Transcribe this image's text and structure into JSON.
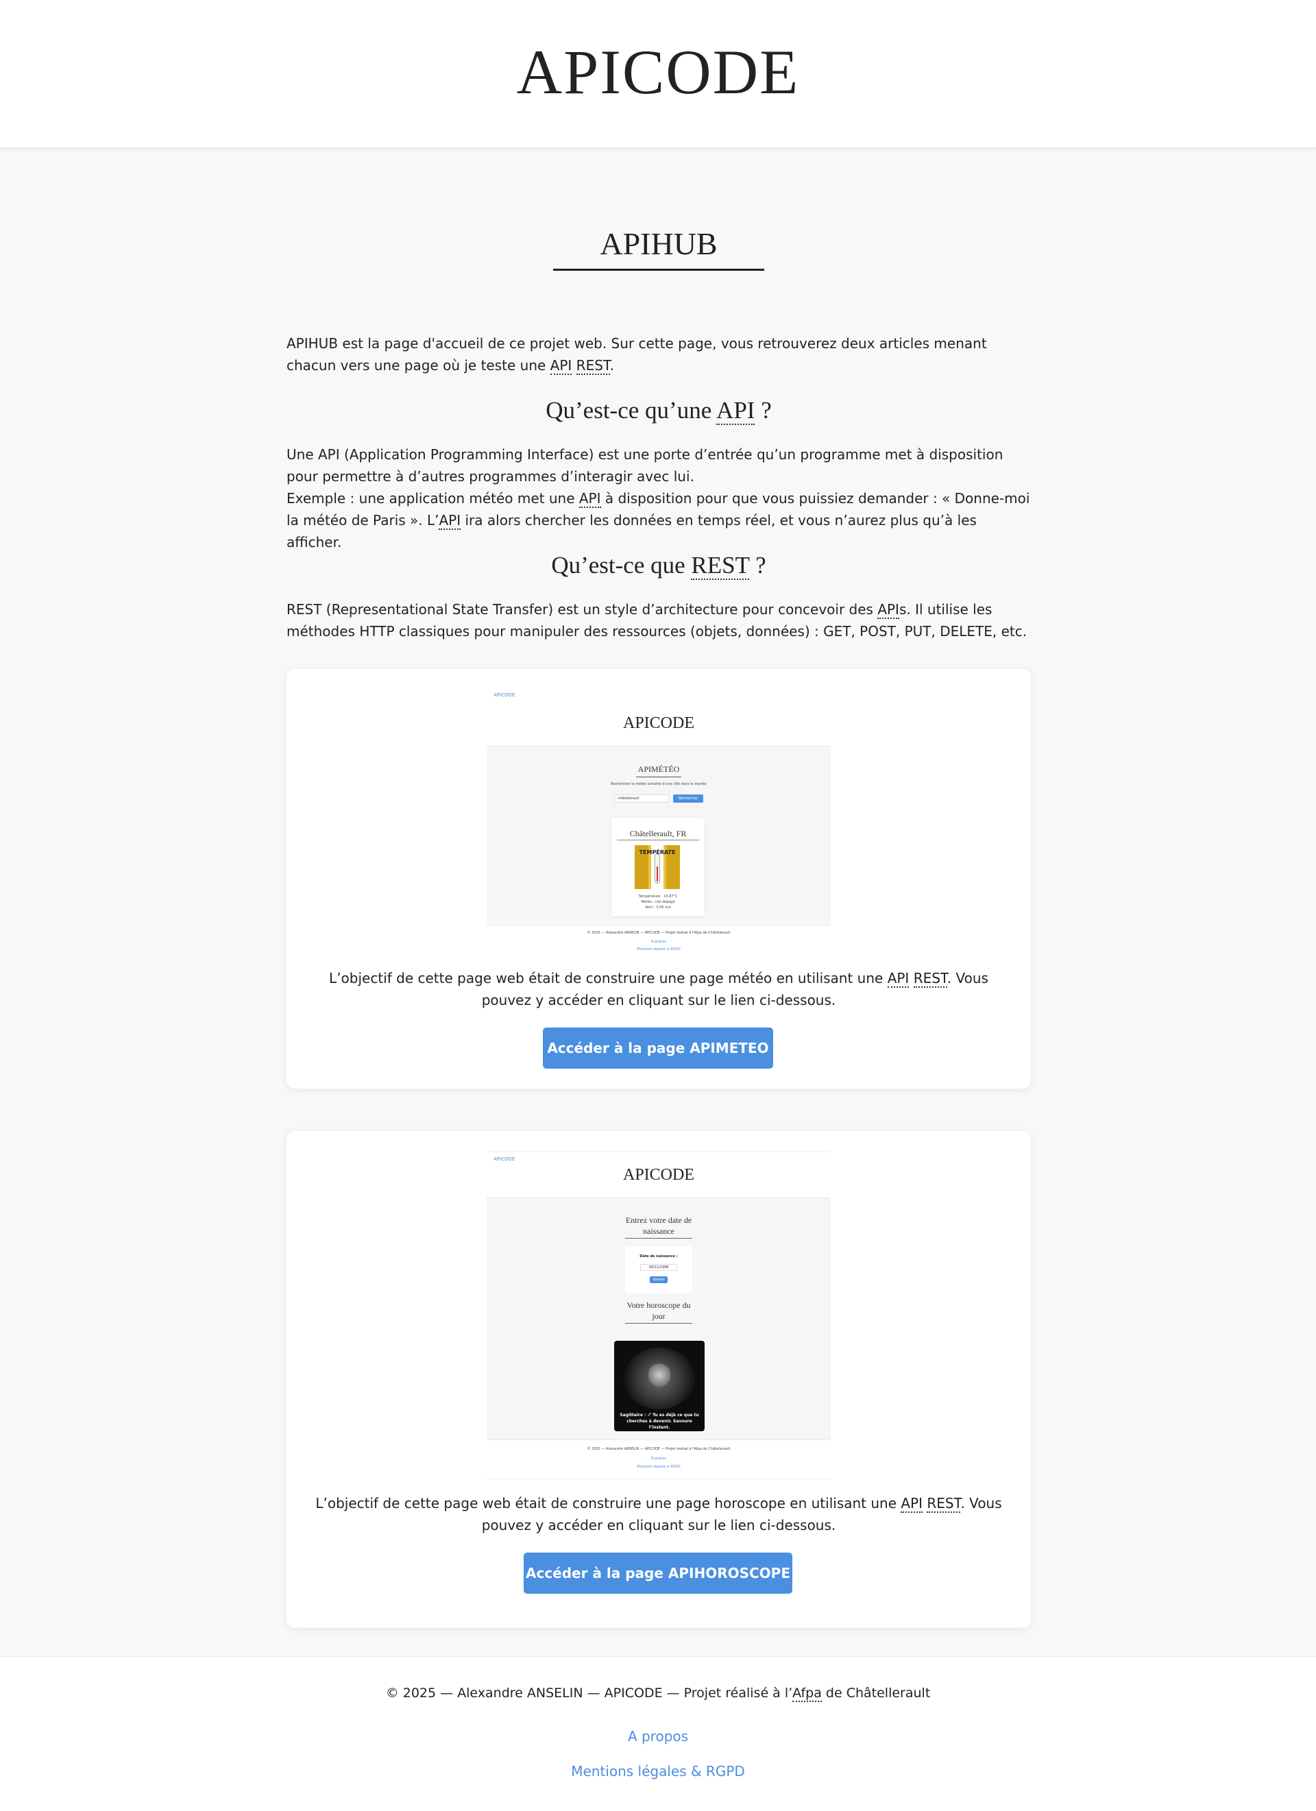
{
  "header": {
    "site_title": "APICODE"
  },
  "main": {
    "page_title": "APIHUB",
    "intro": {
      "text": "APIHUB est la page d'accueil de ce projet web. Sur cette page, vous retrouverez deux articles menant chacun vers une page où je teste une ",
      "abbr1": "API",
      "abbr2": "REST",
      "end": "."
    },
    "section_api": {
      "title_pre": "Qu’est-ce qu’une ",
      "title_abbr": "API",
      "title_post": " ?",
      "line1": "Une API (Application Programming Interface) est une porte d’entrée qu’un programme met à disposition pour permettre à d’autres programmes d’interagir avec lui.",
      "line2_pre": "Exemple : une application météo met une ",
      "line2_abbr1": "API",
      "line2_mid": " à disposition pour que vous puissiez demander : « Donne-moi la météo de Paris ». L’",
      "line2_abbr2": "API",
      "line2_post": " ira alors chercher les données en temps réel, et vous n’aurez plus qu’à les afficher."
    },
    "section_rest": {
      "title_pre": "Qu’est-ce que ",
      "title_abbr": "REST",
      "title_post": " ?",
      "text_pre": "REST (Representational State Transfer) est un style d’architecture pour concevoir des ",
      "text_abbr": "API",
      "text_post": "s. Il utilise les méthodes HTTP classiques pour manipuler des ressources (objets, données) : GET, POST, PUT, DELETE, etc."
    },
    "cards": [
      {
        "text_pre": "L’objectif de cette page web était de construire une page météo en utilisant une ",
        "abbr1": "API",
        "abbr2": "REST",
        "text_post": ". Vous pouvez y accéder en cliquant sur le lien ci-dessous.",
        "button": "Accéder à la page APIMETEO",
        "preview": {
          "logo": "APICODE",
          "site_title": "APICODE",
          "heading": "APIMÉTÉO",
          "subtitle": "Rechercher la météo actuelle d'une ville dans le monde",
          "search_value": "châtellerault",
          "search_button": "Rechercher",
          "city": "Châtellerault, FR",
          "badge": "TEMPÉRATE",
          "stat1": "Température : 19.87°C",
          "stat2": "Météo : ciel dégagé",
          "stat3": "Vent : 3.09 m/s",
          "footer": "© 2025 — Alexandre ANSELIN — APICODE — Projet réalisé à l'Afpa de Châtellerault",
          "link1": "À propos",
          "link2": "Mentions légales & RGPD"
        }
      },
      {
        "text_pre": "L’objectif de cette page web était de construire une page horoscope en utilisant une ",
        "abbr1": "API",
        "abbr2": "REST",
        "text_post": ". Vous pouvez y accéder en cliquant sur le lien ci-dessous.",
        "button": "Accéder à la page APIHOROSCOPE",
        "preview": {
          "logo": "APICODE",
          "site_title": "APICODE",
          "heading1": "Entrez votre date de naissance",
          "form_label": "Date de naissance :",
          "date_value": "06/11/1998",
          "submit": "Valider",
          "heading2": "Votre horoscope du jour",
          "caption": "Sagittaire : ♐ Tu es déjà ce que tu cherches à devenir. Savoure l’instant.",
          "footer": "© 2025 — Alexandre ANSELIN — APICODE — Projet réalisé à l'Afpa de Châtellerault",
          "link1": "À propos",
          "link2": "Mentions légales & RGPD"
        }
      }
    ]
  },
  "footer": {
    "copy_pre": "© 2025 — Alexandre ANSELIN — APICODE — Projet réalisé à l’",
    "copy_abbr": "Afpa",
    "copy_post": " de Châtellerault",
    "link_about": "A propos",
    "link_legal": "Mentions légales & RGPD"
  },
  "colors": {
    "accent": "#4a8fe0",
    "background": "#f8f8f8",
    "text": "#222222"
  }
}
